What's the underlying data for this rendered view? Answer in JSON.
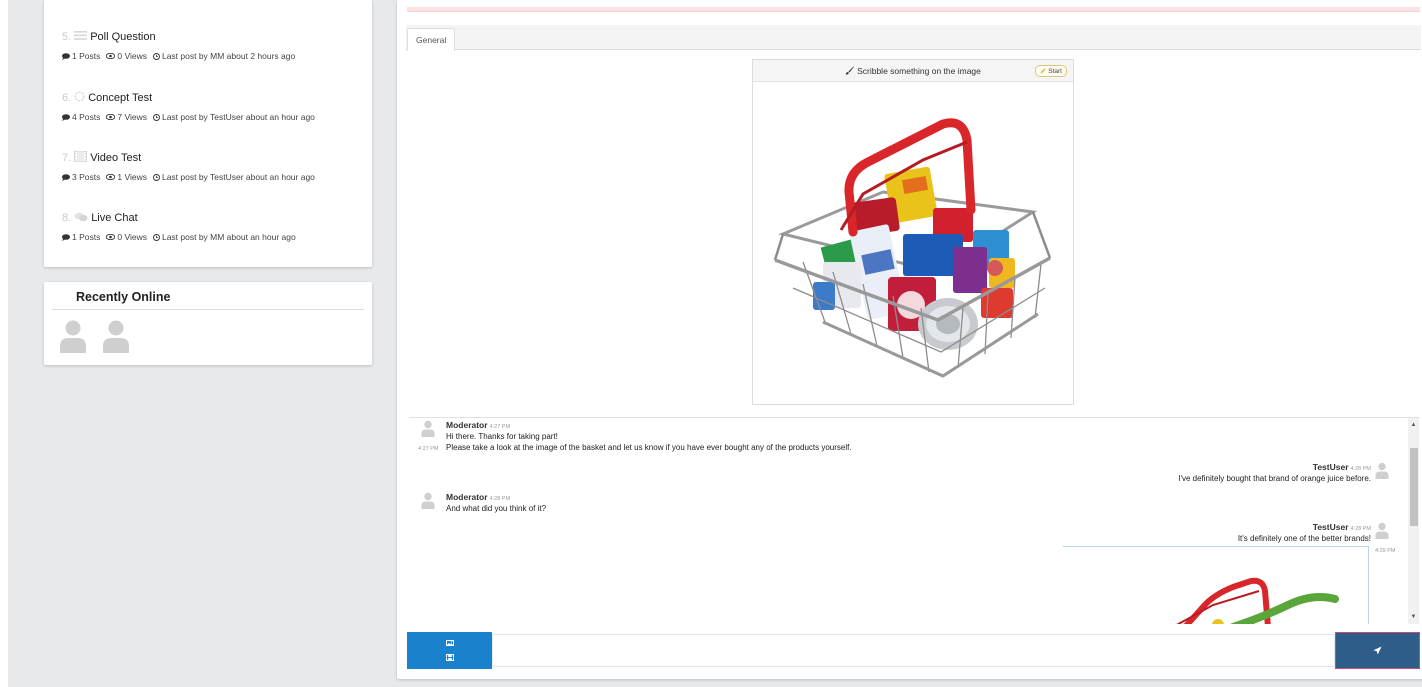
{
  "topics": [
    {
      "num": "5.",
      "icon": "list-icon",
      "title": "Poll Question",
      "posts": "1 Posts",
      "views": "0 Views",
      "last_post": "Last post by MM about 2 hours ago"
    },
    {
      "num": "6.",
      "icon": "spinner-icon",
      "title": "Concept Test",
      "posts": "4 Posts",
      "views": "7 Views",
      "last_post": "Last post by TestUser about an hour ago"
    },
    {
      "num": "7.",
      "icon": "film-icon",
      "title": "Video Test",
      "posts": "3 Posts",
      "views": "1 Views",
      "last_post": "Last post by TestUser about an hour ago"
    },
    {
      "num": "8.",
      "icon": "chat-icon",
      "title": "Live Chat",
      "posts": "1 Posts",
      "views": "0 Views",
      "last_post": "Last post by MM about an hour ago"
    }
  ],
  "recently_online": {
    "title": "Recently Online"
  },
  "tabs": [
    {
      "label": "General"
    }
  ],
  "image_panel": {
    "header": "Scribble something on the image",
    "start_label": "Start"
  },
  "chat": {
    "messages": [
      {
        "name": "Moderator",
        "time": "4:27 PM",
        "lines": [
          "Hi there. Thanks for taking part!",
          "Please take a look at the image of the basket and let us know if you have ever bought any of the products yourself."
        ],
        "side_time": "4:27 PM",
        "align": "left"
      },
      {
        "name": "TestUser",
        "time": "4:28 PM",
        "lines": [
          "I've definitely bought that brand of orange juice before."
        ],
        "align": "right"
      },
      {
        "name": "Moderator",
        "time": "4:28 PM",
        "lines": [
          "And what did you think of it?"
        ],
        "align": "left"
      },
      {
        "name": "TestUser",
        "time": "4:28 PM",
        "lines": [
          "It's definitely one of the better brands!"
        ],
        "side_time": "4:29 PM",
        "align": "right"
      }
    ]
  },
  "composer": {
    "attach_icons": [
      "image-icon",
      "video-icon"
    ],
    "send_icon": "send-icon"
  },
  "colors": {
    "attach_button": "#1a82cc",
    "send_button": "#2e5d8a",
    "basket_red": "#d9262b",
    "scribble_green": "#5aa63a"
  }
}
